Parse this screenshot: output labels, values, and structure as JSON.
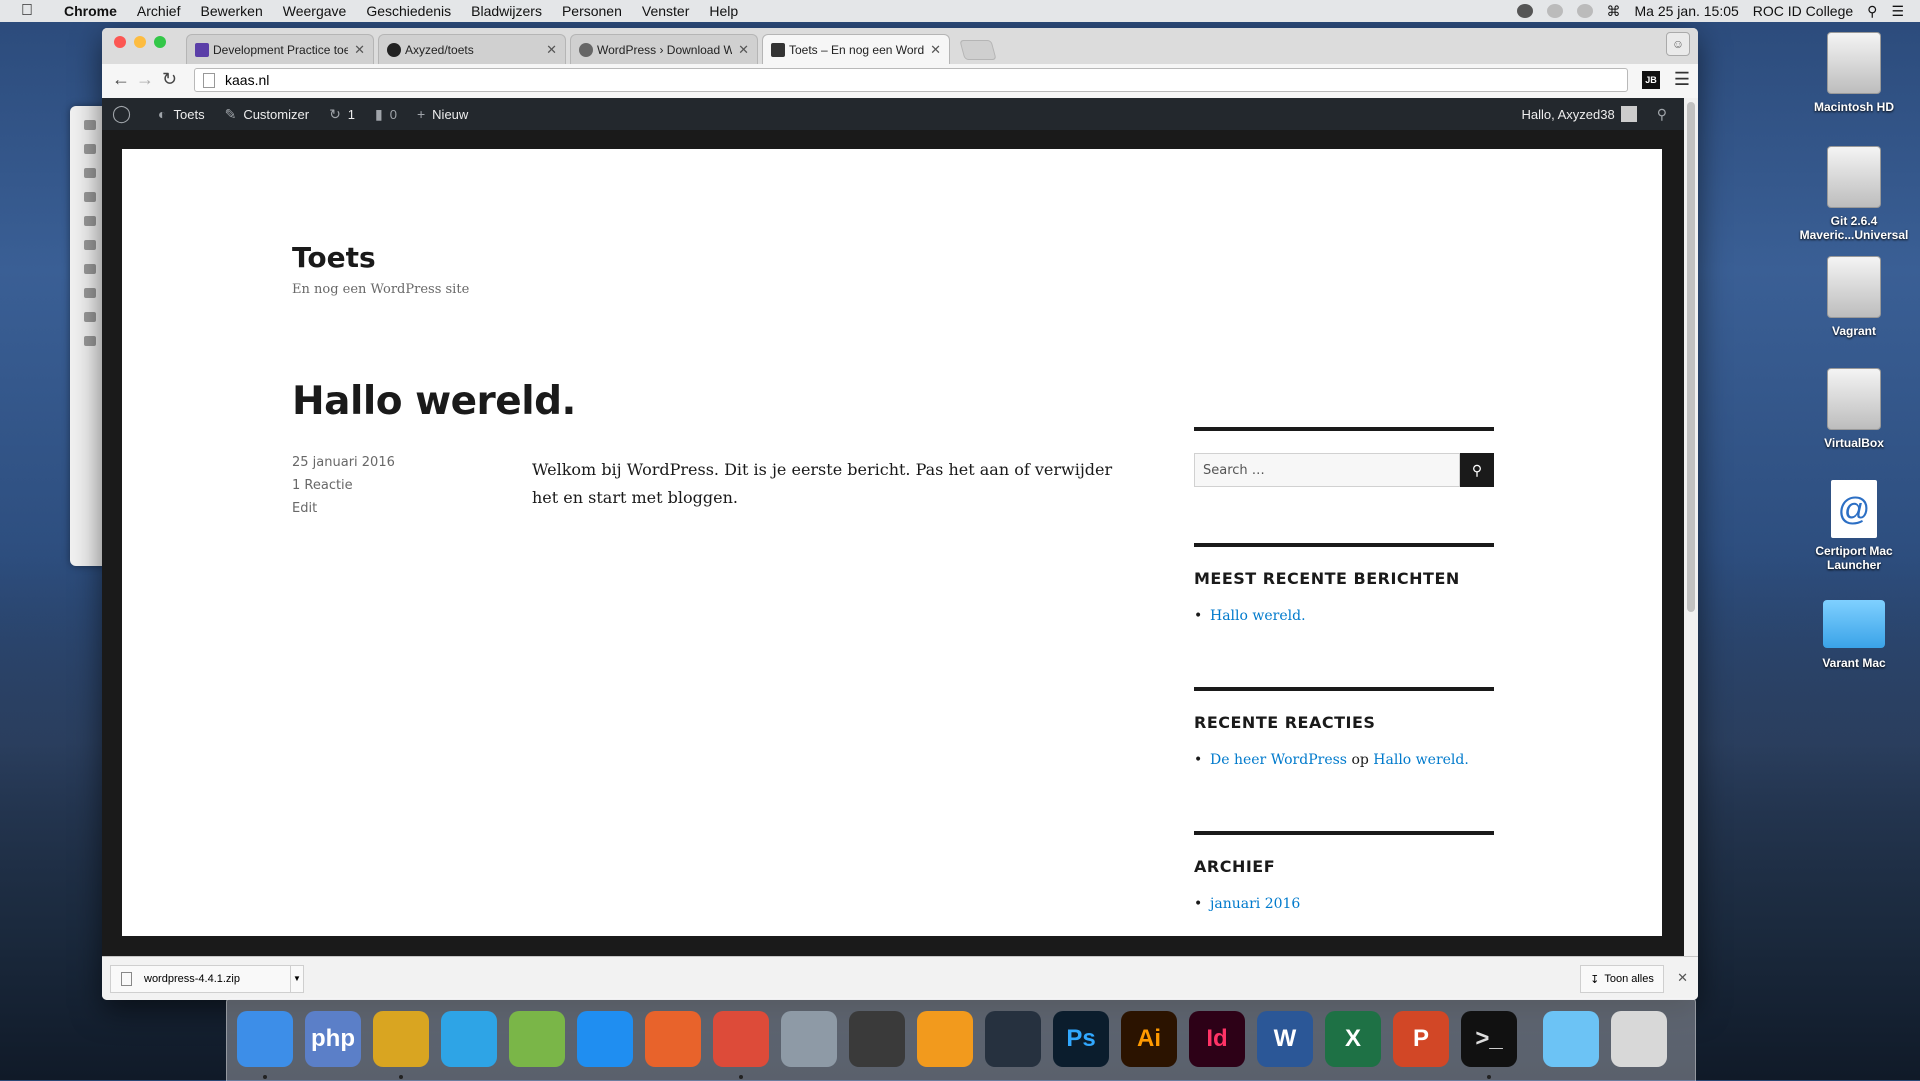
{
  "menubar": {
    "apple": "",
    "items": [
      "Chrome",
      "Archief",
      "Bewerken",
      "Weergave",
      "Geschiedenis",
      "Bladwijzers",
      "Personen",
      "Venster",
      "Help"
    ],
    "clock": "Ma 25 jan.  15:05",
    "user": "ROC ID College"
  },
  "browser": {
    "tabs": [
      {
        "title": "Development Practice toets",
        "favicon_color": "#5b3fa8"
      },
      {
        "title": "Axyzed/toets",
        "favicon_color": "#222222"
      },
      {
        "title": "WordPress › Download Wo",
        "favicon_color": "#666666"
      },
      {
        "title": "Toets – En nog een WordPr",
        "favicon_color": "#333333"
      }
    ],
    "active_tab": 3,
    "url": "kaas.nl",
    "ext_label": "JB"
  },
  "adminbar": {
    "site_name": "Toets",
    "customizer": "Customizer",
    "updates_count": "1",
    "comments_count": "0",
    "new_label": "Nieuw",
    "greeting": "Hallo, Axyzed38"
  },
  "site": {
    "title": "Toets",
    "description": "En nog een WordPress site"
  },
  "post": {
    "title": "Hallo wereld.",
    "date": "25 januari 2016",
    "comments": "1 Reactie",
    "edit": "Edit",
    "body": "Welkom bij WordPress. Dit is je eerste bericht. Pas het aan of verwijder het en start met bloggen."
  },
  "sidebar": {
    "search_placeholder": "Search …",
    "recent_posts_title": "MEEST RECENTE BERICHTEN",
    "recent_posts": [
      "Hallo wereld."
    ],
    "recent_comments_title": "RECENTE REACTIES",
    "recent_comment": {
      "author": "De heer WordPress",
      "joiner": "op",
      "post": "Hallo wereld."
    },
    "archive_title": "ARCHIEF",
    "archive": [
      "januari 2016"
    ]
  },
  "downloads": {
    "file": "wordpress-4.4.1.zip",
    "show_all": "Toon alles"
  },
  "desktop": [
    {
      "label": "Macintosh HD",
      "icon": "drive-icon"
    },
    {
      "label": "Git 2.6.4 Maveric...Universal",
      "icon": "drive-icon"
    },
    {
      "label": "Vagrant",
      "icon": "drive-icon"
    },
    {
      "label": "VirtualBox",
      "icon": "drive-icon"
    },
    {
      "label": "Certiport Mac Launcher",
      "icon": "at-document-icon"
    },
    {
      "label": "Varant Mac",
      "icon": "folder-icon"
    }
  ],
  "dock": [
    {
      "name": "finder-icon",
      "label": "",
      "bg": "#3d8ee8",
      "fg": "#ffffff"
    },
    {
      "name": "php-icon",
      "label": "php",
      "bg": "#5b7fc8",
      "fg": "#ffffff"
    },
    {
      "name": "filezilla-icon",
      "label": "",
      "bg": "#d9a521",
      "fg": "#ffffff"
    },
    {
      "name": "jetbrains-icon",
      "label": "",
      "bg": "#2ea4e6",
      "fg": "#ffffff"
    },
    {
      "name": "cyberduck-icon",
      "label": "",
      "bg": "#7ab648",
      "fg": "#ffffff"
    },
    {
      "name": "safari-icon",
      "label": "",
      "bg": "#1f8ef1",
      "fg": "#ffffff"
    },
    {
      "name": "firefox-icon",
      "label": "",
      "bg": "#e8632b",
      "fg": "#ffffff"
    },
    {
      "name": "chrome-icon",
      "label": "",
      "bg": "#dd4b39",
      "fg": "#ffffff"
    },
    {
      "name": "system-preferences-icon",
      "label": "",
      "bg": "#8e9aa6",
      "fg": "#ffffff"
    },
    {
      "name": "final-cut-icon",
      "label": "",
      "bg": "#3a3a3a",
      "fg": "#ffffff"
    },
    {
      "name": "vectorize-icon",
      "label": "",
      "bg": "#f29a1d",
      "fg": "#ffffff"
    },
    {
      "name": "cinema4d-icon",
      "label": "",
      "bg": "#26313f",
      "fg": "#ffffff"
    },
    {
      "name": "photoshop-icon",
      "label": "Ps",
      "bg": "#0b1d2d",
      "fg": "#31a8ff"
    },
    {
      "name": "illustrator-icon",
      "label": "Ai",
      "bg": "#2b1300",
      "fg": "#ff9a00"
    },
    {
      "name": "indesign-icon",
      "label": "Id",
      "bg": "#2d0117",
      "fg": "#ff3366"
    },
    {
      "name": "word-icon",
      "label": "W",
      "bg": "#2b5797",
      "fg": "#ffffff"
    },
    {
      "name": "excel-icon",
      "label": "X",
      "bg": "#1e7145",
      "fg": "#ffffff"
    },
    {
      "name": "powerpoint-icon",
      "label": "P",
      "bg": "#d24726",
      "fg": "#ffffff"
    },
    {
      "name": "terminal-icon",
      "label": ">_",
      "bg": "#111111",
      "fg": "#dddddd"
    },
    {
      "name": "downloads-folder-icon",
      "label": "",
      "bg": "#6cc3f5",
      "fg": "#ffffff"
    },
    {
      "name": "trash-icon",
      "label": "",
      "bg": "#d8d8d8",
      "fg": "#ffffff"
    }
  ],
  "colors": {
    "link": "#007acc",
    "adminbar": "#23282d",
    "text": "#1a1a1a"
  }
}
